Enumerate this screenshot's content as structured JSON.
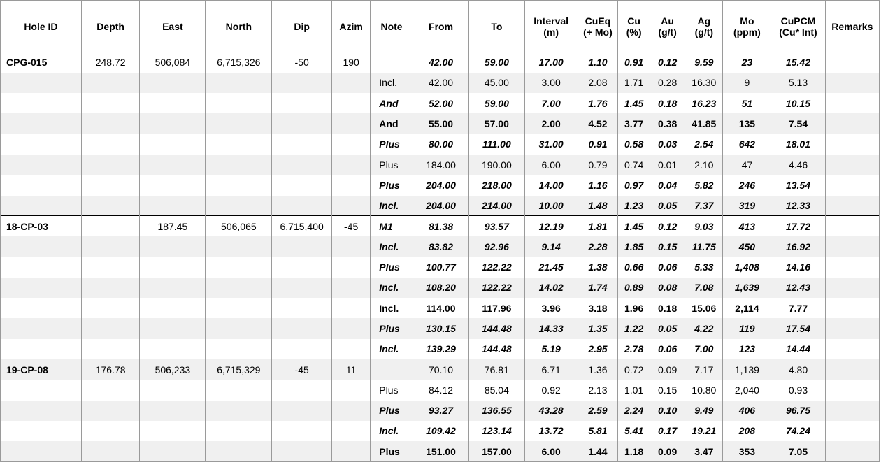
{
  "columns": [
    {
      "key": "hole_id",
      "label": "Hole ID"
    },
    {
      "key": "depth",
      "label": "Depth"
    },
    {
      "key": "east",
      "label": "East"
    },
    {
      "key": "north",
      "label": "North"
    },
    {
      "key": "dip",
      "label": "Dip"
    },
    {
      "key": "azim",
      "label": "Azim"
    },
    {
      "key": "note",
      "label": "Note"
    },
    {
      "key": "from",
      "label": "From"
    },
    {
      "key": "to",
      "label": "To"
    },
    {
      "key": "interval",
      "label": "Interval (m)"
    },
    {
      "key": "cueq",
      "label": "CuEq (+ Mo)"
    },
    {
      "key": "cu",
      "label": "Cu (%)"
    },
    {
      "key": "au",
      "label": "Au (g/t)"
    },
    {
      "key": "ag",
      "label": "Ag (g/t)"
    },
    {
      "key": "mo",
      "label": "Mo (ppm)"
    },
    {
      "key": "cupcm",
      "label": "CuPCM (Cu* Int)"
    },
    {
      "key": "remarks",
      "label": "Remarks"
    }
  ],
  "rows": [
    {
      "hole_id": "CPG-015",
      "depth": "248.72",
      "east": "506,084",
      "north": "6,715,326",
      "dip": "-50",
      "azim": "190",
      "note": "",
      "from": "42.00",
      "to": "59.00",
      "interval": "17.00",
      "cueq": "1.10",
      "cu": "0.91",
      "au": "0.12",
      "ag": "9.59",
      "mo": "23",
      "cupcm": "15.42",
      "remarks": "",
      "style": "bi",
      "note_style": "bi"
    },
    {
      "hole_id": "",
      "depth": "",
      "east": "",
      "north": "",
      "dip": "",
      "azim": "",
      "note": "Incl.",
      "from": "42.00",
      "to": "45.00",
      "interval": "3.00",
      "cueq": "2.08",
      "cu": "1.71",
      "au": "0.28",
      "ag": "16.30",
      "mo": "9",
      "cupcm": "5.13",
      "remarks": "",
      "style": "n",
      "note_style": "n"
    },
    {
      "hole_id": "",
      "depth": "",
      "east": "",
      "north": "",
      "dip": "",
      "azim": "",
      "note": "And",
      "from": "52.00",
      "to": "59.00",
      "interval": "7.00",
      "cueq": "1.76",
      "cu": "1.45",
      "au": "0.18",
      "ag": "16.23",
      "mo": "51",
      "cupcm": "10.15",
      "remarks": "",
      "style": "bi",
      "note_style": "bi"
    },
    {
      "hole_id": "",
      "depth": "",
      "east": "",
      "north": "",
      "dip": "",
      "azim": "",
      "note": "And",
      "from": "55.00",
      "to": "57.00",
      "interval": "2.00",
      "cueq": "4.52",
      "cu": "3.77",
      "au": "0.38",
      "ag": "41.85",
      "mo": "135",
      "cupcm": "7.54",
      "remarks": "",
      "style": "b",
      "note_style": "b"
    },
    {
      "hole_id": "",
      "depth": "",
      "east": "",
      "north": "",
      "dip": "",
      "azim": "",
      "note": "Plus",
      "from": "80.00",
      "to": "111.00",
      "interval": "31.00",
      "cueq": "0.91",
      "cu": "0.58",
      "au": "0.03",
      "ag": "2.54",
      "mo": "642",
      "cupcm": "18.01",
      "remarks": "",
      "style": "bi",
      "note_style": "bi"
    },
    {
      "hole_id": "",
      "depth": "",
      "east": "",
      "north": "",
      "dip": "",
      "azim": "",
      "note": "Plus",
      "from": "184.00",
      "to": "190.00",
      "interval": "6.00",
      "cueq": "0.79",
      "cu": "0.74",
      "au": "0.01",
      "ag": "2.10",
      "mo": "47",
      "cupcm": "4.46",
      "remarks": "",
      "style": "n",
      "note_style": "n"
    },
    {
      "hole_id": "",
      "depth": "",
      "east": "",
      "north": "",
      "dip": "",
      "azim": "",
      "note": "Plus",
      "from": "204.00",
      "to": "218.00",
      "interval": "14.00",
      "cueq": "1.16",
      "cu": "0.97",
      "au": "0.04",
      "ag": "5.82",
      "mo": "246",
      "cupcm": "13.54",
      "remarks": "",
      "style": "bi",
      "note_style": "bi"
    },
    {
      "hole_id": "",
      "depth": "",
      "east": "",
      "north": "",
      "dip": "",
      "azim": "",
      "note": "Incl.",
      "from": "204.00",
      "to": "214.00",
      "interval": "10.00",
      "cueq": "1.48",
      "cu": "1.23",
      "au": "0.05",
      "ag": "7.37",
      "mo": "319",
      "cupcm": "12.33",
      "remarks": "",
      "style": "bi",
      "note_style": "bi"
    },
    {
      "hole_id": "18-CP-03",
      "depth": "",
      "east": "187.45",
      "north": "506,065",
      "dip": "6,715,400",
      "azim": "-45",
      "note": "M1",
      "from": "81.38",
      "to": "93.57",
      "interval": "12.19",
      "cueq": "1.81",
      "cu": "1.45",
      "au": "0.12",
      "ag": "9.03",
      "mo": "413",
      "cupcm": "17.72",
      "remarks": "",
      "style": "bi",
      "note_style": "bi"
    },
    {
      "hole_id": "",
      "depth": "",
      "east": "",
      "north": "",
      "dip": "",
      "azim": "",
      "note": "Incl.",
      "from": "83.82",
      "to": "92.96",
      "interval": "9.14",
      "cueq": "2.28",
      "cu": "1.85",
      "au": "0.15",
      "ag": "11.75",
      "mo": "450",
      "cupcm": "16.92",
      "remarks": "",
      "style": "bi",
      "note_style": "bi"
    },
    {
      "hole_id": "",
      "depth": "",
      "east": "",
      "north": "",
      "dip": "",
      "azim": "",
      "note": "Plus",
      "from": "100.77",
      "to": "122.22",
      "interval": "21.45",
      "cueq": "1.38",
      "cu": "0.66",
      "au": "0.06",
      "ag": "5.33",
      "mo": "1,408",
      "cupcm": "14.16",
      "remarks": "",
      "style": "bi",
      "note_style": "bi"
    },
    {
      "hole_id": "",
      "depth": "",
      "east": "",
      "north": "",
      "dip": "",
      "azim": "",
      "note": "Incl.",
      "from": "108.20",
      "to": "122.22",
      "interval": "14.02",
      "cueq": "1.74",
      "cu": "0.89",
      "au": "0.08",
      "ag": "7.08",
      "mo": "1,639",
      "cupcm": "12.43",
      "remarks": "",
      "style": "bi",
      "note_style": "bi"
    },
    {
      "hole_id": "",
      "depth": "",
      "east": "",
      "north": "",
      "dip": "",
      "azim": "",
      "note": "Incl.",
      "from": "114.00",
      "to": "117.96",
      "interval": "3.96",
      "cueq": "3.18",
      "cu": "1.96",
      "au": "0.18",
      "ag": "15.06",
      "mo": "2,114",
      "cupcm": "7.77",
      "remarks": "",
      "style": "b",
      "note_style": "b"
    },
    {
      "hole_id": "",
      "depth": "",
      "east": "",
      "north": "",
      "dip": "",
      "azim": "",
      "note": "Plus",
      "from": "130.15",
      "to": "144.48",
      "interval": "14.33",
      "cueq": "1.35",
      "cu": "1.22",
      "au": "0.05",
      "ag": "4.22",
      "mo": "119",
      "cupcm": "17.54",
      "remarks": "",
      "style": "bi",
      "note_style": "bi"
    },
    {
      "hole_id": "",
      "depth": "",
      "east": "",
      "north": "",
      "dip": "",
      "azim": "",
      "note": "Incl.",
      "from": "139.29",
      "to": "144.48",
      "interval": "5.19",
      "cueq": "2.95",
      "cu": "2.78",
      "au": "0.06",
      "ag": "7.00",
      "mo": "123",
      "cupcm": "14.44",
      "remarks": "",
      "style": "bi",
      "note_style": "bi"
    },
    {
      "hole_id": "19-CP-08",
      "depth": "176.78",
      "east": "506,233",
      "north": "6,715,329",
      "dip": "-45",
      "azim": "11",
      "note": "",
      "from": "70.10",
      "to": "76.81",
      "interval": "6.71",
      "cueq": "1.36",
      "cu": "0.72",
      "au": "0.09",
      "ag": "7.17",
      "mo": "1,139",
      "cupcm": "4.80",
      "remarks": "",
      "style": "n",
      "note_style": "n"
    },
    {
      "hole_id": "",
      "depth": "",
      "east": "",
      "north": "",
      "dip": "",
      "azim": "",
      "note": "Plus",
      "from": "84.12",
      "to": "85.04",
      "interval": "0.92",
      "cueq": "2.13",
      "cu": "1.01",
      "au": "0.15",
      "ag": "10.80",
      "mo": "2,040",
      "cupcm": "0.93",
      "remarks": "",
      "style": "n",
      "note_style": "n"
    },
    {
      "hole_id": "",
      "depth": "",
      "east": "",
      "north": "",
      "dip": "",
      "azim": "",
      "note": "Plus",
      "from": "93.27",
      "to": "136.55",
      "interval": "43.28",
      "cueq": "2.59",
      "cu": "2.24",
      "au": "0.10",
      "ag": "9.49",
      "mo": "406",
      "cupcm": "96.75",
      "remarks": "",
      "style": "bi",
      "note_style": "bi"
    },
    {
      "hole_id": "",
      "depth": "",
      "east": "",
      "north": "",
      "dip": "",
      "azim": "",
      "note": "Incl.",
      "from": "109.42",
      "to": "123.14",
      "interval": "13.72",
      "cueq": "5.81",
      "cu": "5.41",
      "au": "0.17",
      "ag": "19.21",
      "mo": "208",
      "cupcm": "74.24",
      "remarks": "",
      "style": "bi",
      "note_style": "bi"
    },
    {
      "hole_id": "",
      "depth": "",
      "east": "",
      "north": "",
      "dip": "",
      "azim": "",
      "note": "Plus",
      "from": "151.00",
      "to": "157.00",
      "interval": "6.00",
      "cueq": "1.44",
      "cu": "1.18",
      "au": "0.09",
      "ag": "3.47",
      "mo": "353",
      "cupcm": "7.05",
      "remarks": "",
      "style": "b",
      "note_style": "b"
    }
  ],
  "colors": {
    "alt_row": "#f0f0f0",
    "border": "#9a9a9a",
    "group_border": "#000000"
  }
}
